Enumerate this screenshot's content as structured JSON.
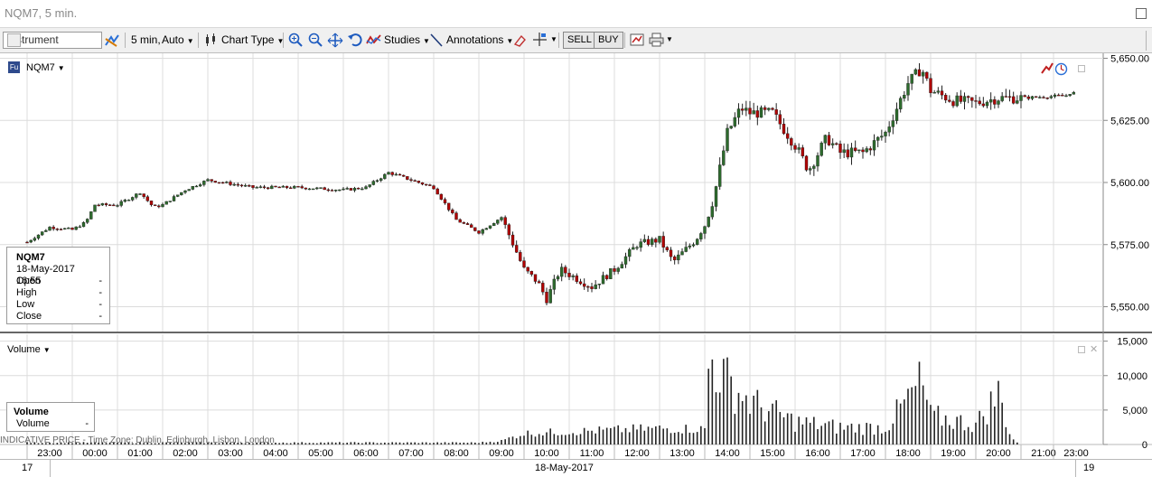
{
  "window": {
    "title": "NQM7, 5 min."
  },
  "toolbar": {
    "instrument_placeholder": "Instrument",
    "interval_label": "5 min,",
    "range_label": "Auto",
    "chart_type_label": "Chart Type",
    "studies_label": "Studies",
    "annotations_label": "Annotations",
    "sell_label": "SELL",
    "buy_label": "BUY"
  },
  "chart": {
    "symbol": "NQM7",
    "symbol_badge": "Fu",
    "price_ticks": [
      "5,650.00",
      "5,625.00",
      "5,600.00",
      "5,575.00",
      "5,550.00"
    ],
    "volume_ticks": [
      "15,000",
      "10,000",
      "5,000",
      "0"
    ],
    "time_ticks": [
      "23:00",
      "00:00",
      "01:00",
      "02:00",
      "03:00",
      "04:00",
      "05:00",
      "06:00",
      "07:00",
      "08:00",
      "09:00",
      "10:00",
      "11:00",
      "12:00",
      "13:00",
      "14:00",
      "15:00",
      "16:00",
      "17:00",
      "18:00",
      "19:00",
      "20:00",
      "21:00",
      "23:00"
    ],
    "date_labels": {
      "left": "17",
      "center": "18-May-2017",
      "right": "19"
    },
    "indicative_text": "INDICATIVE PRICE - Time Zone: Dublin, Edinburgh, Lisbon, London"
  },
  "info_box": {
    "symbol": "NQM7",
    "datetime": "18-May-2017 16:55",
    "rows": [
      {
        "label": "Open",
        "value": "-"
      },
      {
        "label": "High",
        "value": "-"
      },
      {
        "label": "Low",
        "value": "-"
      },
      {
        "label": "Close",
        "value": "-"
      }
    ]
  },
  "volume_panel": {
    "label": "Volume",
    "box_title": "Volume",
    "box_row_label": "Volume",
    "box_row_value": "-"
  },
  "colors": {
    "up": "#2d6b2d",
    "down": "#b00000",
    "grid": "#dcdcdc",
    "volume": "#222222"
  },
  "chart_data": {
    "type": "candlestick",
    "ylim": [
      5540,
      5652
    ],
    "close_anchors": [
      [
        23.0,
        5576
      ],
      [
        23.5,
        5582
      ],
      [
        0.0,
        5581
      ],
      [
        0.3,
        5584
      ],
      [
        0.5,
        5591
      ],
      [
        1.0,
        5591
      ],
      [
        1.5,
        5596
      ],
      [
        1.8,
        5590
      ],
      [
        2.0,
        5591
      ],
      [
        2.5,
        5597
      ],
      [
        3.0,
        5601
      ],
      [
        4.0,
        5598
      ],
      [
        5.0,
        5598
      ],
      [
        6.0,
        5597
      ],
      [
        6.5,
        5598
      ],
      [
        7.0,
        5604
      ],
      [
        7.5,
        5601
      ],
      [
        8.0,
        5598
      ],
      [
        8.5,
        5585
      ],
      [
        9.0,
        5580
      ],
      [
        9.5,
        5586
      ],
      [
        10.0,
        5565
      ],
      [
        10.3,
        5560
      ],
      [
        10.5,
        5553
      ],
      [
        10.8,
        5565
      ],
      [
        11.5,
        5558
      ],
      [
        12.0,
        5565
      ],
      [
        12.5,
        5575
      ],
      [
        13.0,
        5577
      ],
      [
        13.3,
        5568
      ],
      [
        13.8,
        5577
      ],
      [
        14.0,
        5583
      ],
      [
        14.2,
        5594
      ],
      [
        14.5,
        5620
      ],
      [
        14.8,
        5630
      ],
      [
        15.0,
        5628
      ],
      [
        15.5,
        5628
      ],
      [
        16.0,
        5615
      ],
      [
        16.3,
        5605
      ],
      [
        16.7,
        5618
      ],
      [
        17.0,
        5612
      ],
      [
        17.5,
        5612
      ],
      [
        18.0,
        5620
      ],
      [
        18.5,
        5640
      ],
      [
        18.8,
        5646
      ],
      [
        19.0,
        5637
      ],
      [
        19.5,
        5633
      ],
      [
        20.0,
        5632
      ],
      [
        20.5,
        5634
      ],
      [
        21.0,
        5634
      ],
      [
        22.0,
        5635
      ],
      [
        23.0,
        5636
      ]
    ],
    "volume_anchors": [
      [
        23.0,
        300
      ],
      [
        9.0,
        300
      ],
      [
        9.5,
        600
      ],
      [
        10.0,
        1800
      ],
      [
        13.0,
        2600
      ],
      [
        14.0,
        2500
      ],
      [
        14.1,
        15500
      ],
      [
        14.5,
        11000
      ],
      [
        15.0,
        7500
      ],
      [
        16.0,
        4000
      ],
      [
        17.0,
        3000
      ],
      [
        18.0,
        3000
      ],
      [
        18.8,
        11000
      ],
      [
        19.0,
        5000
      ],
      [
        20.0,
        3500
      ],
      [
        20.5,
        9000
      ],
      [
        20.8,
        1000
      ],
      [
        21.0,
        0
      ]
    ]
  }
}
